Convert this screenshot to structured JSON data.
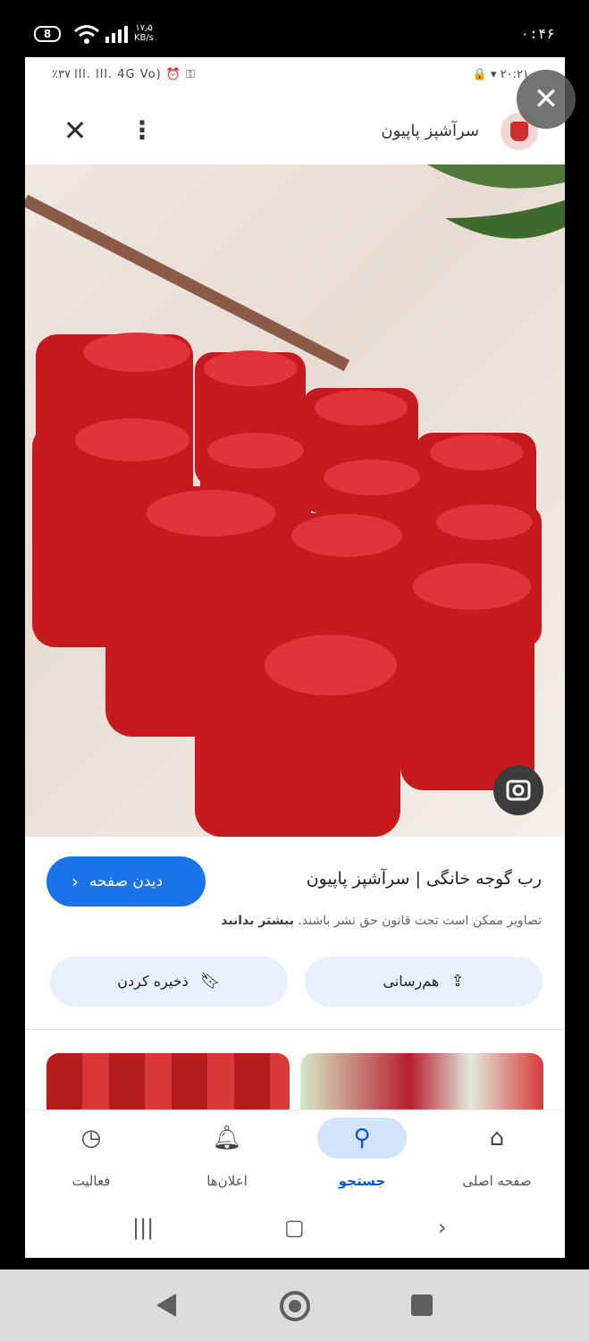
{
  "outer_status": {
    "battery": "8",
    "speed": "۱۷٫۵\nKB/s",
    "clock": "۰:۴۶"
  },
  "inner_status": {
    "left": "٪۳۷ ⅼⅼⅼ. ⅼⅼⅼ. 4G Vo) ⏰ ⚿",
    "right": "🔒 ▾ ۲۰:۲۱"
  },
  "header": {
    "site_name": "سرآشپز پاپیون"
  },
  "result": {
    "visit_label": "دیدن صفحه",
    "title": "رب گوجه خانگی | سرآشپز پاپیون",
    "copyright": "تصاویر ممکن است تحت قانون حق نشر باشند.",
    "learn_more": "بیشتر بدانید",
    "save_label": "ذخیره کردن",
    "share_label": "هم‌رسانی"
  },
  "bottom_nav": {
    "items": [
      {
        "label": "فعالیت",
        "icon": "activity-icon"
      },
      {
        "label": "اعلان‌ها",
        "icon": "bell-icon"
      },
      {
        "label": "جستجو",
        "icon": "search-icon"
      },
      {
        "label": "صفحه اصلی",
        "icon": "home-icon"
      }
    ],
    "active": "جستجو"
  },
  "colors": {
    "accent": "#1a73e8",
    "pill_bg": "#e8f0fe",
    "nav_active_bg": "#d3e3fd"
  }
}
